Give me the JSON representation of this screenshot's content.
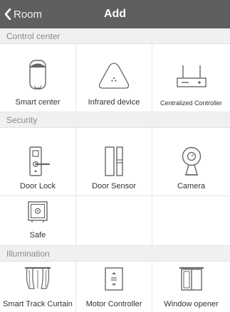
{
  "nav": {
    "back_label": "Room",
    "title": "Add"
  },
  "sections": {
    "control_center": "Control center",
    "security": "Security",
    "illumination": "Illumination"
  },
  "devices": {
    "smart_center": "Smart center",
    "infrared_device": "Infrared device",
    "centralized_controller": "Centralized Controller",
    "door_lock": "Door Lock",
    "door_sensor": "Door Sensor",
    "camera": "Camera",
    "safe": "Safe",
    "smart_track_curtain": "Smart Track Curtain",
    "motor_controller": "Motor Controller",
    "window_opener": "Window opener"
  },
  "icons": {
    "back": "chevron-left-icon",
    "smart_center": "smart-hub-icon",
    "infrared_device": "infrared-device-icon",
    "centralized_controller": "router-icon",
    "door_lock": "door-lock-icon",
    "door_sensor": "door-sensor-icon",
    "camera": "camera-icon",
    "safe": "safe-icon",
    "smart_track_curtain": "curtain-icon",
    "motor_controller": "motor-controller-icon",
    "window_opener": "window-icon"
  },
  "colors": {
    "nav_bg": "#5f5f5f",
    "section_bg": "#f0f0f0",
    "icon_stroke": "#666666"
  }
}
